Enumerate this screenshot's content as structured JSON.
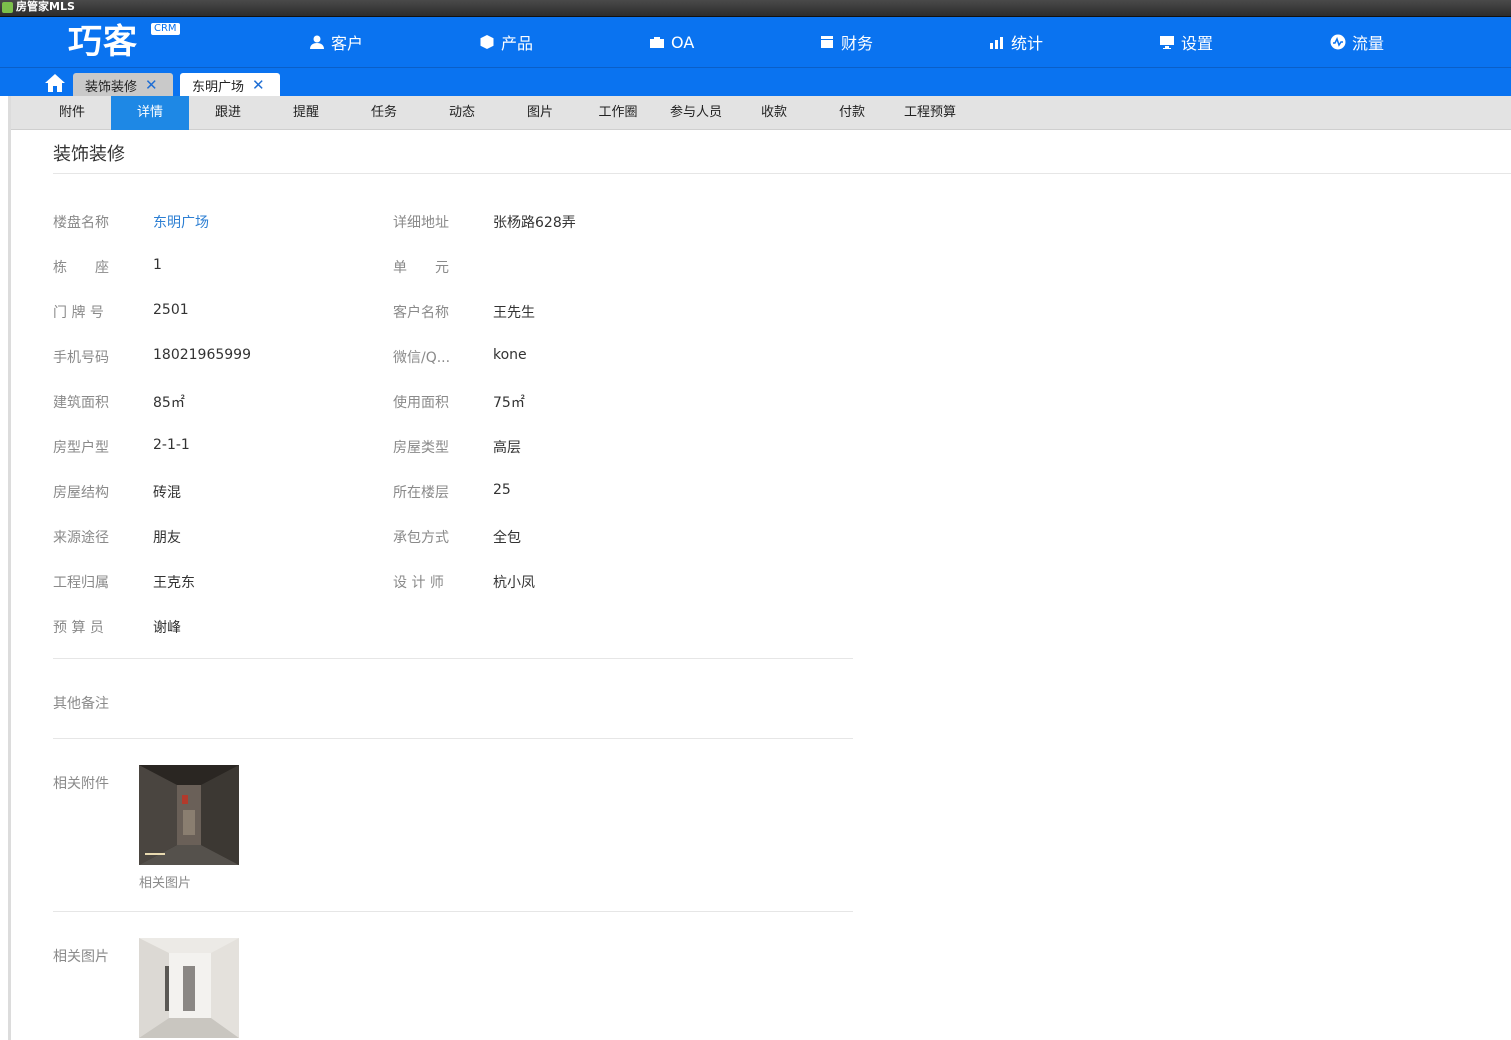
{
  "window": {
    "title": "房管家MLS"
  },
  "logo": {
    "text": "巧客",
    "badge": "CRM"
  },
  "nav": [
    {
      "label": "客户",
      "icon": "user-icon"
    },
    {
      "label": "产品",
      "icon": "cube-icon"
    },
    {
      "label": "OA",
      "icon": "briefcase-icon"
    },
    {
      "label": "财务",
      "icon": "cash-box-icon"
    },
    {
      "label": "统计",
      "icon": "bar-chart-icon"
    },
    {
      "label": "设置",
      "icon": "monitor-icon"
    },
    {
      "label": "流量",
      "icon": "pulse-icon"
    }
  ],
  "open_tabs": [
    {
      "label": "装饰装修",
      "active": false
    },
    {
      "label": "东明广场",
      "active": true
    }
  ],
  "sub_tabs": [
    "附件",
    "详情",
    "跟进",
    "提醒",
    "任务",
    "动态",
    "图片",
    "工作圈",
    "参与人员",
    "收款",
    "付款",
    "工程预算"
  ],
  "active_sub_tab": "详情",
  "page_title": "装饰装修",
  "fields": {
    "building_name": {
      "label": "楼盘名称",
      "value": "东明广场"
    },
    "address": {
      "label": "详细地址",
      "value": "张杨路628弄"
    },
    "block": {
      "label": "栋　　座",
      "value": "1"
    },
    "unit": {
      "label": "单　　元",
      "value": ""
    },
    "door_no": {
      "label": "门 牌 号",
      "value": "2501"
    },
    "customer": {
      "label": "客户名称",
      "value": "王先生"
    },
    "phone": {
      "label": "手机号码",
      "value": "18021965999"
    },
    "wechat": {
      "label": "微信/Q...",
      "value": "kone"
    },
    "build_area": {
      "label": "建筑面积",
      "value": "85㎡"
    },
    "use_area": {
      "label": "使用面积",
      "value": "75㎡"
    },
    "layout": {
      "label": "房型户型",
      "value": "2-1-1"
    },
    "house_type": {
      "label": "房屋类型",
      "value": "高层"
    },
    "structure": {
      "label": "房屋结构",
      "value": "砖混"
    },
    "floor": {
      "label": "所在楼层",
      "value": "25"
    },
    "source": {
      "label": "来源途径",
      "value": "朋友"
    },
    "contract": {
      "label": "承包方式",
      "value": "全包"
    },
    "project_owner": {
      "label": "工程归属",
      "value": "王克东"
    },
    "designer": {
      "label": "设 计 师",
      "value": "杭小凤"
    },
    "budgeter": {
      "label": "预 算 员",
      "value": "谢峰"
    }
  },
  "notes": {
    "label": "其他备注",
    "value": ""
  },
  "attachments": {
    "label": "相关附件",
    "caption": "相关图片"
  },
  "images": {
    "label": "相关图片"
  }
}
